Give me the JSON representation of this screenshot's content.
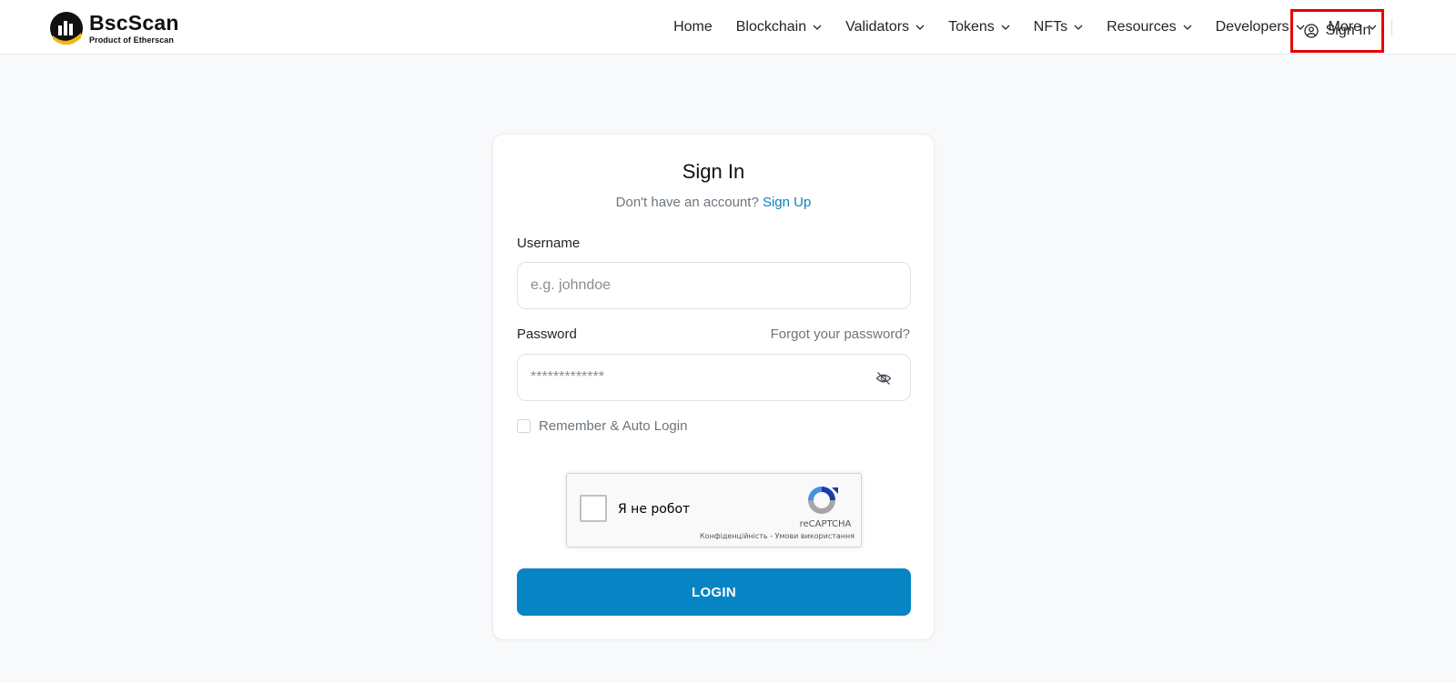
{
  "header": {
    "logo_title": "BscScan",
    "logo_sub": "Product of Etherscan",
    "nav": [
      {
        "label": "Home",
        "dropdown": false
      },
      {
        "label": "Blockchain",
        "dropdown": true
      },
      {
        "label": "Validators",
        "dropdown": true
      },
      {
        "label": "Tokens",
        "dropdown": true
      },
      {
        "label": "NFTs",
        "dropdown": true
      },
      {
        "label": "Resources",
        "dropdown": true
      },
      {
        "label": "Developers",
        "dropdown": true
      },
      {
        "label": "More",
        "dropdown": true
      }
    ],
    "sign_in_label": "Sign In"
  },
  "card": {
    "title": "Sign In",
    "subtitle_text": "Don't have an account?",
    "signup_link": "Sign Up",
    "username_label": "Username",
    "username_placeholder": "e.g. johndoe",
    "password_label": "Password",
    "forgot_link": "Forgot your password?",
    "password_placeholder": "*************",
    "remember_label": "Remember & Auto Login",
    "login_button": "LOGIN"
  },
  "recaptcha": {
    "label": "Я не робот",
    "brand": "reCAPTCHA",
    "privacy": "Конфіденційність",
    "separator": " - ",
    "terms": "Умови використання"
  },
  "colors": {
    "accent": "#0784c3",
    "highlight_border": "#e60000",
    "logo_yellow": "#f0b90b"
  }
}
